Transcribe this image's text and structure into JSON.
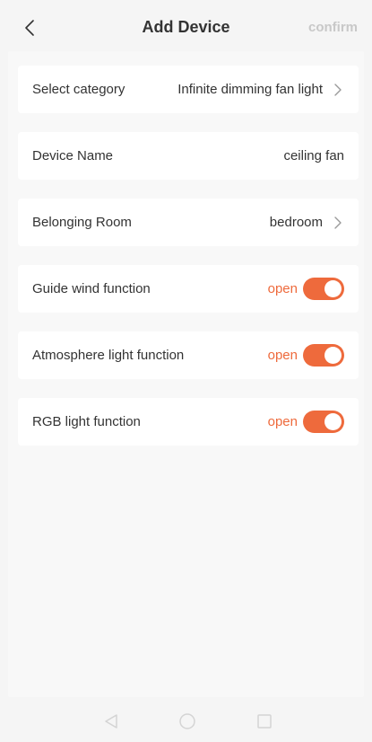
{
  "header": {
    "title": "Add Device",
    "confirm_label": "confirm",
    "back_icon": "chevron-left-icon"
  },
  "rows": [
    {
      "label": "Select category",
      "value": "Infinite dimming fan light",
      "chevron": true
    },
    {
      "label": "Device Name",
      "value": "ceiling fan",
      "chevron": false
    },
    {
      "label": "Belonging Room",
      "value": "bedroom",
      "chevron": true
    },
    {
      "label": "Guide wind function",
      "status": "open",
      "toggle_on": true
    },
    {
      "label": "Atmosphere light function",
      "status": "open",
      "toggle_on": true
    },
    {
      "label": "RGB light function",
      "status": "open",
      "toggle_on": true
    }
  ],
  "colors": {
    "accent": "#ee6a3c",
    "text": "#333333",
    "muted": "#c8c8c8",
    "card": "#ffffff",
    "background": "#f5f5f5"
  },
  "navbar": {
    "icons": [
      "nav-back-icon",
      "nav-home-icon",
      "nav-recents-icon"
    ]
  }
}
